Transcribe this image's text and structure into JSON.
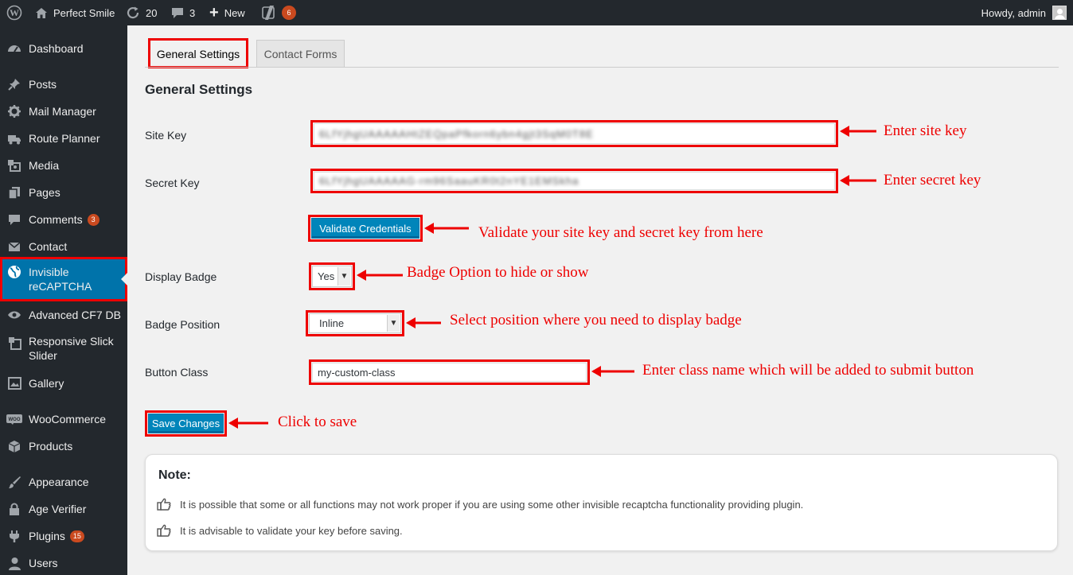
{
  "adminbar": {
    "site_name": "Perfect Smile",
    "updates_count": "20",
    "comments_count": "3",
    "new_label": "New",
    "seo_badge": "6",
    "howdy": "Howdy, admin"
  },
  "sidebar": {
    "items": [
      {
        "label": "Dashboard",
        "icon": "dashboard-icon"
      },
      {
        "label": "Posts",
        "icon": "pin-icon"
      },
      {
        "label": "Mail Manager",
        "icon": "gear-icon"
      },
      {
        "label": "Route Planner",
        "icon": "truck-icon"
      },
      {
        "label": "Media",
        "icon": "media-icon"
      },
      {
        "label": "Pages",
        "icon": "pages-icon"
      },
      {
        "label": "Comments",
        "icon": "comment-icon",
        "count": "3"
      },
      {
        "label": "Contact",
        "icon": "mail-icon"
      },
      {
        "label": "Invisible reCAPTCHA",
        "icon": "globe-icon"
      },
      {
        "label": "Advanced CF7 DB",
        "icon": "eye-icon"
      },
      {
        "label": "Responsive Slick Slider",
        "icon": "slider-icon"
      },
      {
        "label": "Gallery",
        "icon": "gallery-icon"
      },
      {
        "label": "WooCommerce",
        "icon": "woo-icon"
      },
      {
        "label": "Products",
        "icon": "box-icon"
      },
      {
        "label": "Appearance",
        "icon": "brush-icon"
      },
      {
        "label": "Age Verifier",
        "icon": "lock-icon"
      },
      {
        "label": "Plugins",
        "icon": "plug-icon",
        "count": "15"
      },
      {
        "label": "Users",
        "icon": "user-icon"
      }
    ]
  },
  "tabs": [
    "General Settings",
    "Contact Forms"
  ],
  "main": {
    "heading": "General Settings",
    "site_key_label": "Site Key",
    "site_key_value": "6LfYjhgUAAAAAHtZEQpaPfkorn6ybn4gjt3SqM0T8E",
    "secret_key_label": "Secret Key",
    "secret_key_value": "6LfYjhgUAAAAAG-rm96SaauKR0t2nYE1EMSkha",
    "validate_button": "Validate Credentials",
    "display_badge_label": "Display Badge",
    "display_badge_value": "Yes",
    "badge_position_label": "Badge Position",
    "badge_position_value": "Inline",
    "button_class_label": "Button Class",
    "button_class_value": "my-custom-class",
    "save_button": "Save Changes"
  },
  "annotations": {
    "site_key": "Enter site key",
    "secret_key": "Enter secret key",
    "validate": "Validate your site key and secret key from here",
    "badge": "Badge Option to hide or show",
    "position": "Select position where you need to display badge",
    "button_class": "Enter class name which will be added to submit button",
    "save": "Click to save"
  },
  "note": {
    "title": "Note:",
    "lines": [
      "It is possible that some or all functions may not work proper if you are using some other invisible recaptcha functionality providing plugin.",
      "It is advisable to validate your key before saving."
    ]
  },
  "colors": {
    "adminbar_bg": "#23282d",
    "accent_blue": "#0073aa",
    "highlight_red": "#e00000",
    "badge_orange": "#ca4a1f"
  }
}
